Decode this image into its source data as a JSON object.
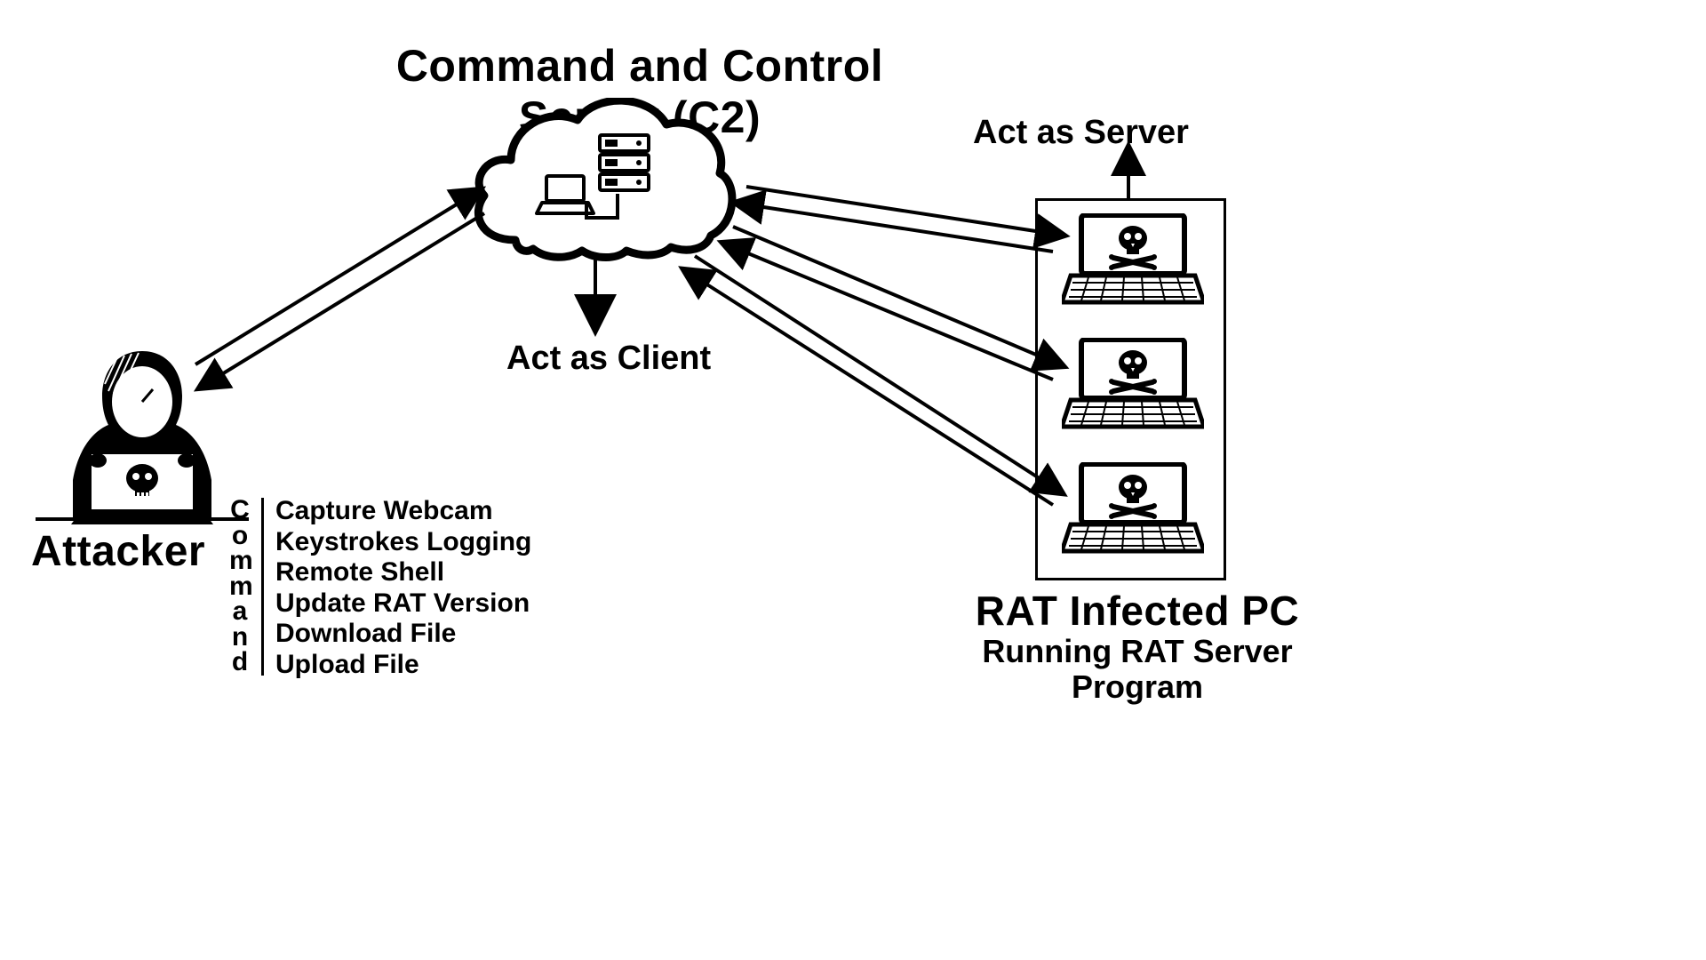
{
  "title": "Command and Control Server (C2)",
  "labels": {
    "attacker": "Attacker",
    "act_as_client": "Act as Client",
    "act_as_server": "Act as Server",
    "rat_infected": "RAT Infected PC",
    "running_rat_1": "Running RAT Server",
    "running_rat_2": "Program",
    "command_vertical": "Command"
  },
  "commands": [
    "Capture Webcam",
    "Keystrokes Logging",
    "Remote Shell",
    "Update RAT Version",
    "Download File",
    "Upload File"
  ]
}
